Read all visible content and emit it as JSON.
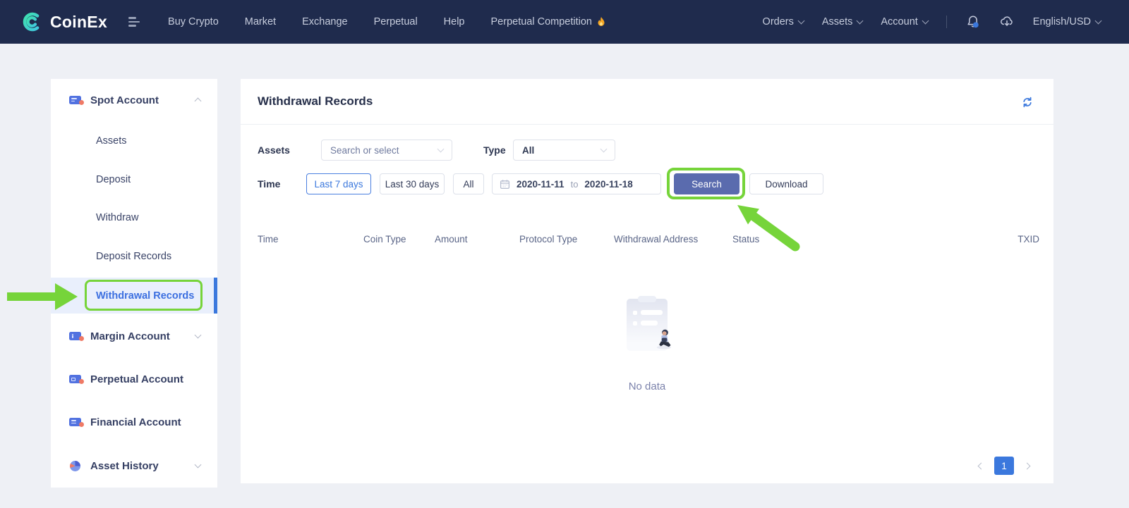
{
  "navbar": {
    "brand": "CoinEx",
    "menu": [
      "Buy Crypto",
      "Market",
      "Exchange",
      "Perpetual",
      "Help",
      "Perpetual Competition"
    ],
    "right": [
      "Orders",
      "Assets",
      "Account"
    ],
    "locale": "English/USD",
    "flame_icon": "🔥"
  },
  "sidebar": {
    "items": [
      {
        "label": "Spot Account",
        "type": "group",
        "icon": "spot-account-icon"
      },
      {
        "label": "Assets",
        "type": "sub"
      },
      {
        "label": "Deposit",
        "type": "sub"
      },
      {
        "label": "Withdraw",
        "type": "sub"
      },
      {
        "label": "Deposit Records",
        "type": "sub"
      },
      {
        "label": "Withdrawal Records",
        "type": "sub",
        "active": true
      },
      {
        "label": "Margin Account",
        "type": "group",
        "icon": "margin-account-icon"
      },
      {
        "label": "Perpetual Account",
        "type": "group",
        "icon": "perpetual-account-icon"
      },
      {
        "label": "Financial Account",
        "type": "group",
        "icon": "financial-account-icon"
      },
      {
        "label": "Asset History",
        "type": "group",
        "icon": "asset-history-icon"
      }
    ]
  },
  "content": {
    "title": "Withdrawal Records",
    "filters": {
      "assets_label": "Assets",
      "assets_placeholder": "Search or select",
      "type_label": "Type",
      "type_value": "All",
      "time_label": "Time",
      "time_buttons": [
        "Last 7 days",
        "Last 30 days",
        "All"
      ],
      "active_time_button": "Last 7 days",
      "date_from": "2020-11-11",
      "date_separator": "to",
      "date_to": "2020-11-18",
      "search_label": "Search",
      "download_label": "Download"
    },
    "table": {
      "headers": [
        "Time",
        "Coin Type",
        "Amount",
        "Protocol Type",
        "Withdrawal Address",
        "Status",
        "TXID"
      ]
    },
    "empty_text": "No data",
    "pagination": {
      "current_page": "1"
    }
  },
  "colors": {
    "navbar_bg": "#1f2b4d",
    "brand_teal": "#3ddbc4",
    "primary_blue": "#3b78dd",
    "search_button": "#5a6bae",
    "annotation_green": "#76d43a",
    "active_item_bg": "#e9effc"
  }
}
